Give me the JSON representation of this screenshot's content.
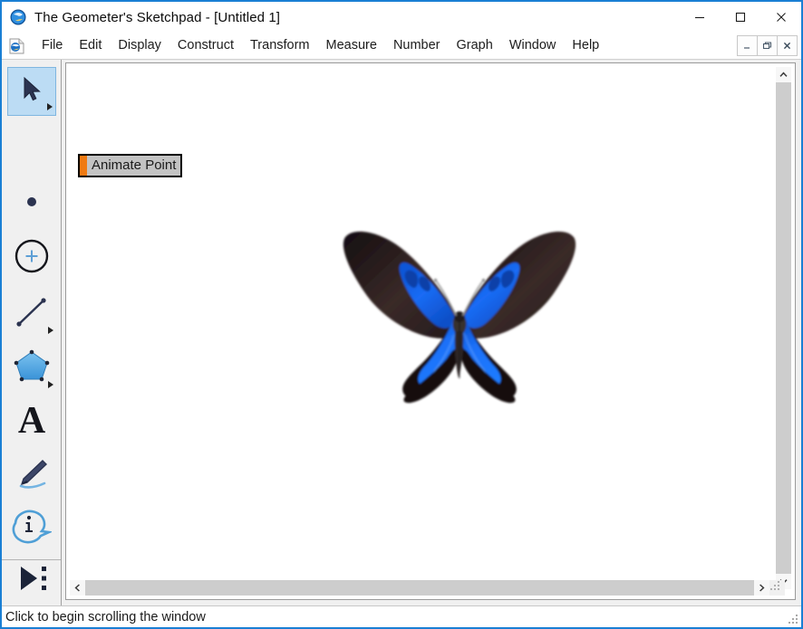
{
  "window": {
    "title": "The Geometer's Sketchpad - [Untitled 1]",
    "app_icon": "sketchpad-globe-icon",
    "accent_color": "#1a7fd4",
    "controls": {
      "minimize": "Minimize",
      "maximize": "Maximize",
      "close": "Close"
    }
  },
  "menu": {
    "doc_icon": "document-icon",
    "items": [
      {
        "label": "File"
      },
      {
        "label": "Edit"
      },
      {
        "label": "Display"
      },
      {
        "label": "Construct"
      },
      {
        "label": "Transform"
      },
      {
        "label": "Measure"
      },
      {
        "label": "Number"
      },
      {
        "label": "Graph"
      },
      {
        "label": "Window"
      },
      {
        "label": "Help"
      }
    ],
    "mdi_controls": {
      "minimize": "Minimize Document",
      "restore": "Restore Document",
      "close": "Close Document"
    }
  },
  "toolbar": {
    "tools": [
      {
        "name": "arrow-select-tool",
        "icon": "arrow-cursor-icon",
        "selected": true,
        "has_flyout": true
      },
      {
        "name": "point-tool",
        "icon": "point-icon",
        "selected": false,
        "has_flyout": false
      },
      {
        "name": "compass-tool",
        "icon": "circle-plus-icon",
        "selected": false,
        "has_flyout": false
      },
      {
        "name": "straightedge-tool",
        "icon": "segment-icon",
        "selected": false,
        "has_flyout": true
      },
      {
        "name": "polygon-tool",
        "icon": "pentagon-icon",
        "selected": false,
        "has_flyout": true
      },
      {
        "name": "text-tool",
        "icon": "letter-a-icon",
        "selected": false,
        "has_flyout": false
      },
      {
        "name": "marker-tool",
        "icon": "pen-marker-icon",
        "selected": false,
        "has_flyout": false
      },
      {
        "name": "information-tool",
        "icon": "info-bubble-icon",
        "selected": false,
        "has_flyout": false
      },
      {
        "name": "custom-tool",
        "icon": "play-dots-icon",
        "selected": false,
        "has_flyout": false
      }
    ]
  },
  "canvas": {
    "animate_button": {
      "label": "Animate Point",
      "bar_color": "#f07a12",
      "fill_color": "#c3c3c3",
      "border_color": "#000000"
    },
    "figure": {
      "name": "butterfly-image",
      "description": "Blue Ulysses swallowtail butterfly",
      "wing_blue": "#1464f0",
      "wing_dark": "#1a1014"
    }
  },
  "scrollbars": {
    "vertical": {
      "up_arrow": "scroll-up-icon",
      "down_arrow": "scroll-down-icon"
    },
    "horizontal": {
      "left_arrow": "scroll-left-icon",
      "right_arrow": "scroll-right-icon"
    }
  },
  "status": {
    "message": "Click to begin scrolling the window",
    "resize_grip": "resize-grip-icon"
  }
}
